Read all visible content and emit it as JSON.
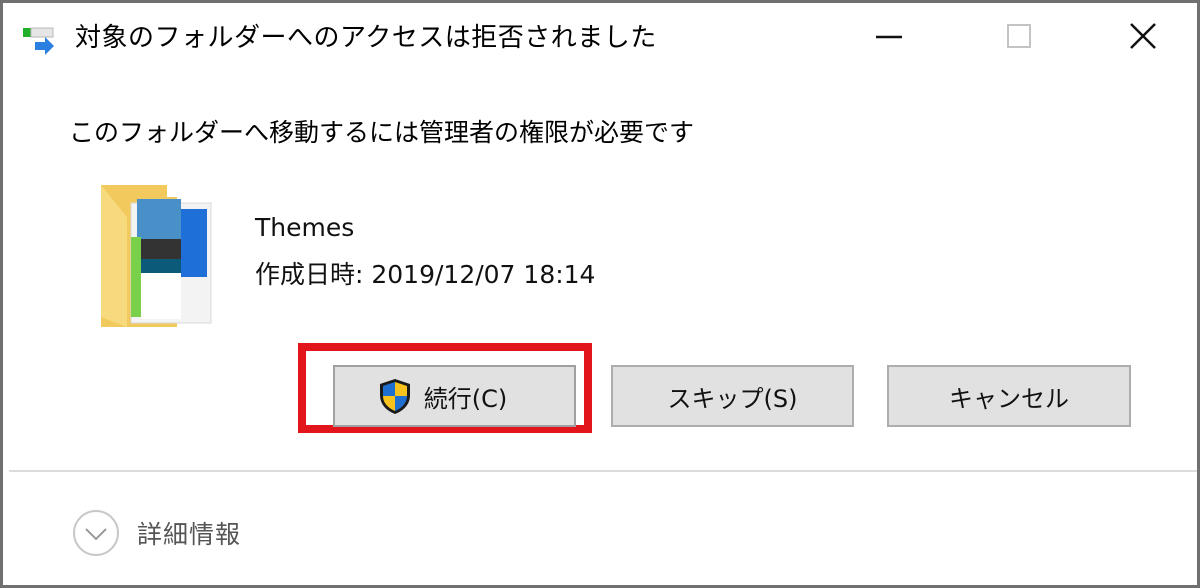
{
  "window": {
    "title": "対象のフォルダーへのアクセスは拒否されました",
    "icon": "folder-move-icon",
    "controls": {
      "minimize_icon": "minimize-icon",
      "maximize_icon": "maximize-icon",
      "close_icon": "close-icon"
    }
  },
  "dialog": {
    "message": "このフォルダーへ移動するには管理者の権限が必要です",
    "item": {
      "icon": "folder-icon",
      "name": "Themes",
      "created": "作成日時: 2019/12/07 18:14"
    },
    "buttons": {
      "continue": {
        "label": "続行(C)",
        "icon": "uac-shield-icon",
        "highlighted": true
      },
      "skip": {
        "label": "スキップ(S)"
      },
      "cancel": {
        "label": "キャンセル"
      }
    },
    "highlight_color": "#e2141c",
    "details": {
      "label": "詳細情報",
      "icon": "chevron-down-circle-icon"
    }
  }
}
